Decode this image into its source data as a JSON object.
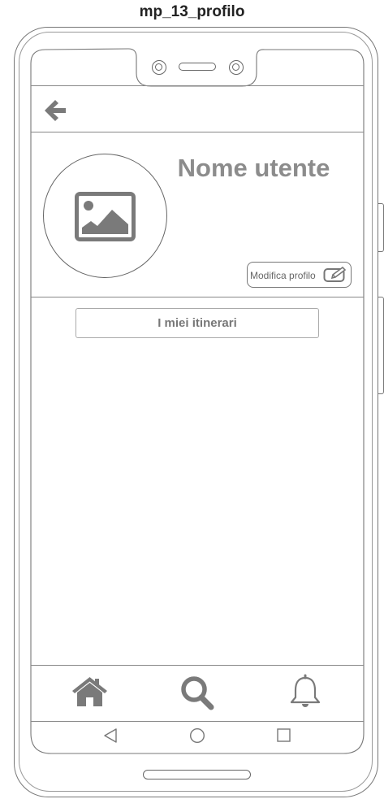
{
  "screen": {
    "title": "mp_13_profilo"
  },
  "header": {
    "back_icon": "arrow-left-icon"
  },
  "profile": {
    "avatar_icon": "image-placeholder-icon",
    "username": "Nome utente",
    "edit_label": "Modifica profilo",
    "edit_icon": "pencil-edit-icon"
  },
  "content": {
    "itineraries_label": "I miei itinerari"
  },
  "bottom_nav": {
    "items": [
      {
        "icon": "home-icon"
      },
      {
        "icon": "search-icon"
      },
      {
        "icon": "bell-icon"
      }
    ]
  },
  "system_nav": {
    "icons": [
      "back-triangle-icon",
      "home-circle-icon",
      "recents-square-icon"
    ]
  },
  "colors": {
    "icon_gray": "#7a7a7a",
    "outline": "#777777",
    "text_gray": "#8c8c8c"
  }
}
